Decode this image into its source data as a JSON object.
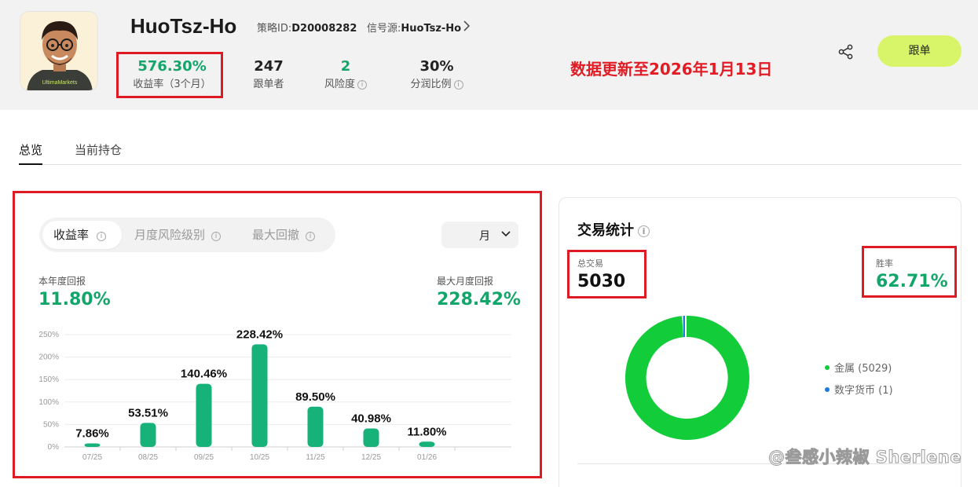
{
  "header": {
    "name": "HuoTsz-Ho",
    "strategy_label": "策略ID:",
    "strategy_id": "D20008282",
    "signal_label": "信号源:",
    "signal_source": "HuoTsz-Ho",
    "avatar_shirt_text": "UltimaMarkets",
    "notice": "数据更新至2026年1月13日",
    "follow_label": "跟单",
    "stats": [
      {
        "value": "576.30%",
        "label": "收益率（3个月）"
      },
      {
        "value": "247",
        "label": "跟单者"
      },
      {
        "value": "2",
        "label": "风险度"
      },
      {
        "value": "30%",
        "label": "分润比例"
      }
    ]
  },
  "tabs": [
    {
      "label": "总览"
    },
    {
      "label": "当前持仓"
    }
  ],
  "returns_panel": {
    "segments": [
      {
        "label": "收益率"
      },
      {
        "label": "月度风险级别"
      },
      {
        "label": "最大回撤"
      }
    ],
    "period": "月",
    "annual_label": "本年度回报",
    "annual_value": "11.80%",
    "max_month_label": "最大月度回报",
    "max_month_value": "228.42%"
  },
  "chart_data": {
    "type": "bar",
    "categories": [
      "07/25",
      "08/25",
      "09/25",
      "10/25",
      "11/25",
      "12/25",
      "01/26"
    ],
    "values": [
      7.86,
      53.51,
      140.46,
      228.42,
      89.5,
      40.98,
      11.8
    ],
    "value_labels": [
      "7.86%",
      "53.51%",
      "140.46%",
      "228.42%",
      "89.50%",
      "40.98%",
      "11.80%"
    ],
    "yticks": [
      "0%",
      "50%",
      "100%",
      "150%",
      "200%",
      "250%"
    ],
    "ylim": [
      0,
      250
    ],
    "grid": true,
    "bar_color": "#17b27a"
  },
  "trade_stats": {
    "title": "交易统计",
    "total_label": "总交易",
    "total_value": "5030",
    "win_label": "胜率",
    "win_value": "62.71%",
    "legend": [
      {
        "label": "金属 (5029)",
        "color": "#12cc3a",
        "count": 5029
      },
      {
        "label": "数字货币 (1)",
        "color": "#1d7be0",
        "count": 1
      }
    ]
  },
  "watermark": "@叁感小辣椒 Sherlene",
  "colors": {
    "accent_green": "#13a66b",
    "highlight_red": "#e01a22",
    "follow_button": "#d8f56a"
  }
}
